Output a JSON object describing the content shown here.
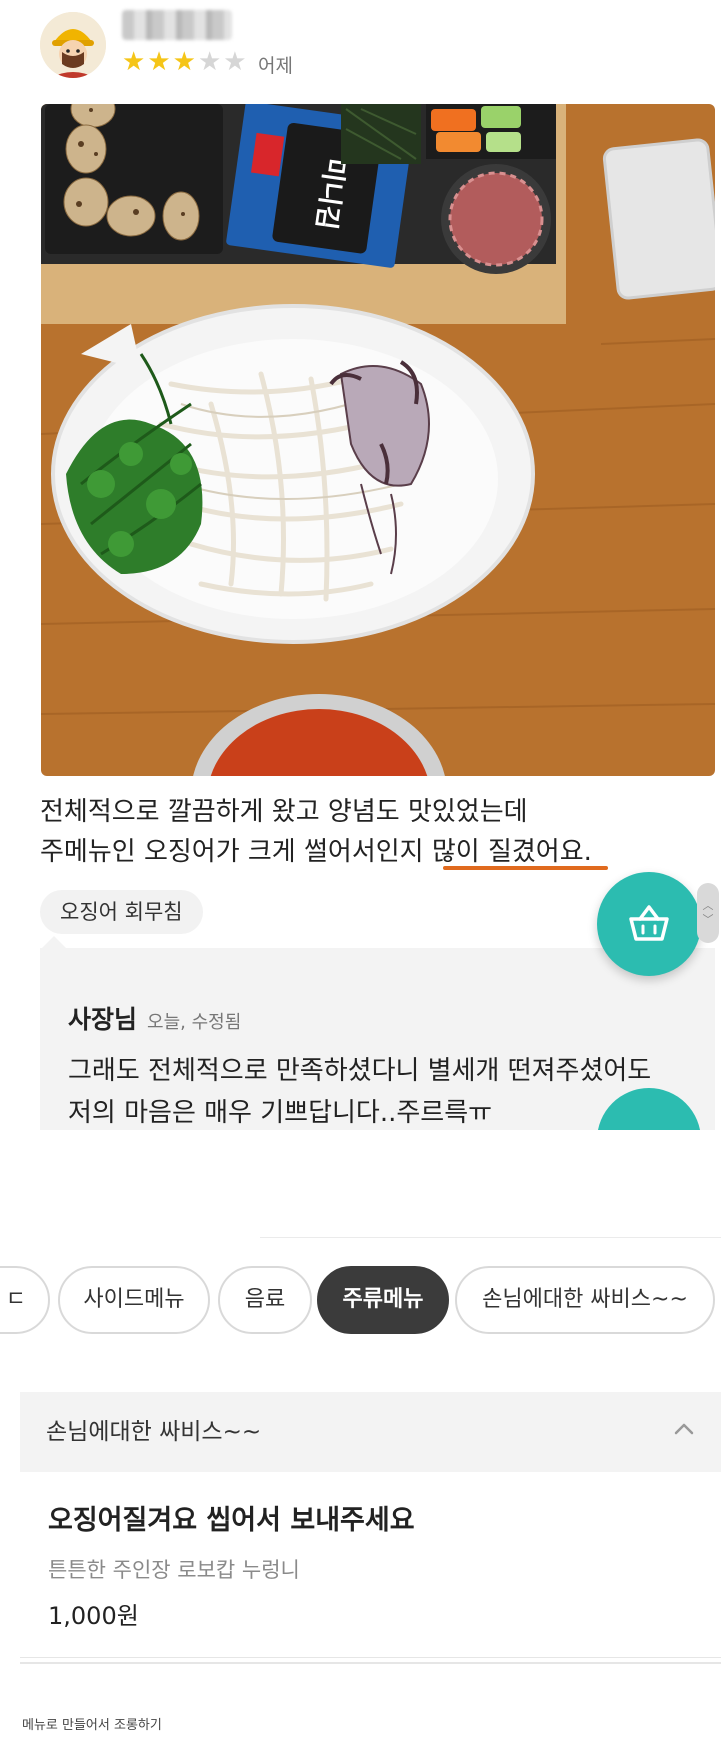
{
  "review": {
    "date": "어제",
    "rating": 3,
    "rating_max": 5,
    "star_on": "★",
    "star_off": "★",
    "text_line1": "전체적으로 깔끔하게 왔고 양념도 맛있었는데",
    "text_line2_prefix": "주메뉴인 오징어가 크게 썰어서인지 ",
    "text_line2_emphasis": "많이 질겼어요",
    "text_line2_suffix": ".",
    "menu_tag": "오징어 회무침",
    "photo_packet_text": "미니김"
  },
  "reply": {
    "author": "사장님",
    "meta": "오늘, 수정됨",
    "line1": "그래도 전체적으로 만족하셨다니 별세개 떤져주셨어도",
    "line2": "저의 마음은 매우 기쁘답니다..주르륵ㅠ"
  },
  "floating": {
    "cart_icon": "basket-icon",
    "scroll_up": "︿",
    "scroll_down": "﹀"
  },
  "menu": {
    "chips": [
      {
        "label": "ㄷ",
        "active": false
      },
      {
        "label": "사이드메뉴",
        "active": false
      },
      {
        "label": "음료",
        "active": false
      },
      {
        "label": "주류메뉴",
        "active": true
      },
      {
        "label": "손님에대한 싸비스~~",
        "active": false
      }
    ],
    "section_title": "손님에대한 싸비스~~",
    "item": {
      "name": "오징어질겨요 씹어서 보내주세요",
      "description": "튼튼한 주인장 로보캅 누렁니",
      "price": "1,000원"
    }
  },
  "caption": "메뉴로 만들어서 조롱하기",
  "colors": {
    "accent_teal": "#2cbcb0",
    "star": "#f5c518",
    "underline": "#e06a1e",
    "active_chip": "#3b3b3b"
  }
}
